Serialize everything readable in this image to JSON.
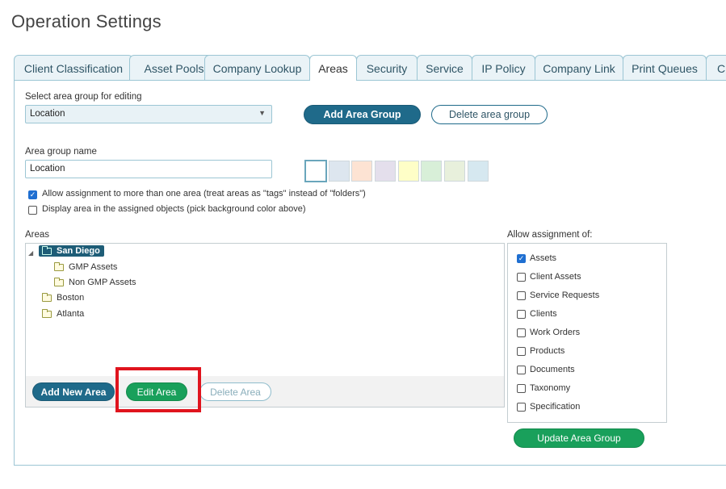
{
  "page": {
    "title": "Operation Settings"
  },
  "tabs": [
    {
      "label": "Client Classification",
      "active": false
    },
    {
      "label": "Asset Pools",
      "active": false
    },
    {
      "label": "Company Lookup",
      "active": false
    },
    {
      "label": "Areas",
      "active": true
    },
    {
      "label": "Security",
      "active": false
    },
    {
      "label": "Service",
      "active": false
    },
    {
      "label": "IP Policy",
      "active": false
    },
    {
      "label": "Company Link",
      "active": false
    },
    {
      "label": "Print Queues",
      "active": false
    },
    {
      "label": "Ch",
      "active": false
    }
  ],
  "area_group": {
    "select_label": "Select area group for editing",
    "selected_value": "Location",
    "add_button": "Add Area Group",
    "delete_button": "Delete area group",
    "name_label": "Area group name",
    "name_value": "Location"
  },
  "colors": {
    "swatches": [
      "#ffffff",
      "#dde6ef",
      "#fde3d3",
      "#e4dfec",
      "#fefec7",
      "#d8efd8",
      "#e8f0dc",
      "#d6e8f0"
    ],
    "accent": "#1f6a8a",
    "success": "#19a05b",
    "highlight": "#e0141e"
  },
  "options": [
    {
      "label": "Allow assignment to more than one area (treat areas as \"tags\" instead of \"folders\")",
      "checked": true
    },
    {
      "label": "Display area in the assigned objects (pick background color above)",
      "checked": false
    }
  ],
  "areas": {
    "label": "Areas",
    "tree": [
      {
        "label": "San Diego",
        "level": 0,
        "expanded": true,
        "selected": true
      },
      {
        "label": "GMP Assets",
        "level": 1,
        "selected": false
      },
      {
        "label": "Non GMP Assets",
        "level": 1,
        "selected": false
      },
      {
        "label": "Boston",
        "level": 0,
        "selected": false
      },
      {
        "label": "Atlanta",
        "level": 0,
        "selected": false
      }
    ],
    "add_button": "Add New Area",
    "edit_button": "Edit Area",
    "delete_button": "Delete Area"
  },
  "allow_assignment": {
    "label": "Allow assignment of:",
    "items": [
      {
        "label": "Assets",
        "checked": true
      },
      {
        "label": "Client Assets",
        "checked": false
      },
      {
        "label": "Service Requests",
        "checked": false
      },
      {
        "label": "Clients",
        "checked": false
      },
      {
        "label": "Work Orders",
        "checked": false
      },
      {
        "label": "Products",
        "checked": false
      },
      {
        "label": "Documents",
        "checked": false
      },
      {
        "label": "Taxonomy",
        "checked": false
      },
      {
        "label": "Specification",
        "checked": false
      }
    ],
    "update_button": "Update Area Group"
  }
}
